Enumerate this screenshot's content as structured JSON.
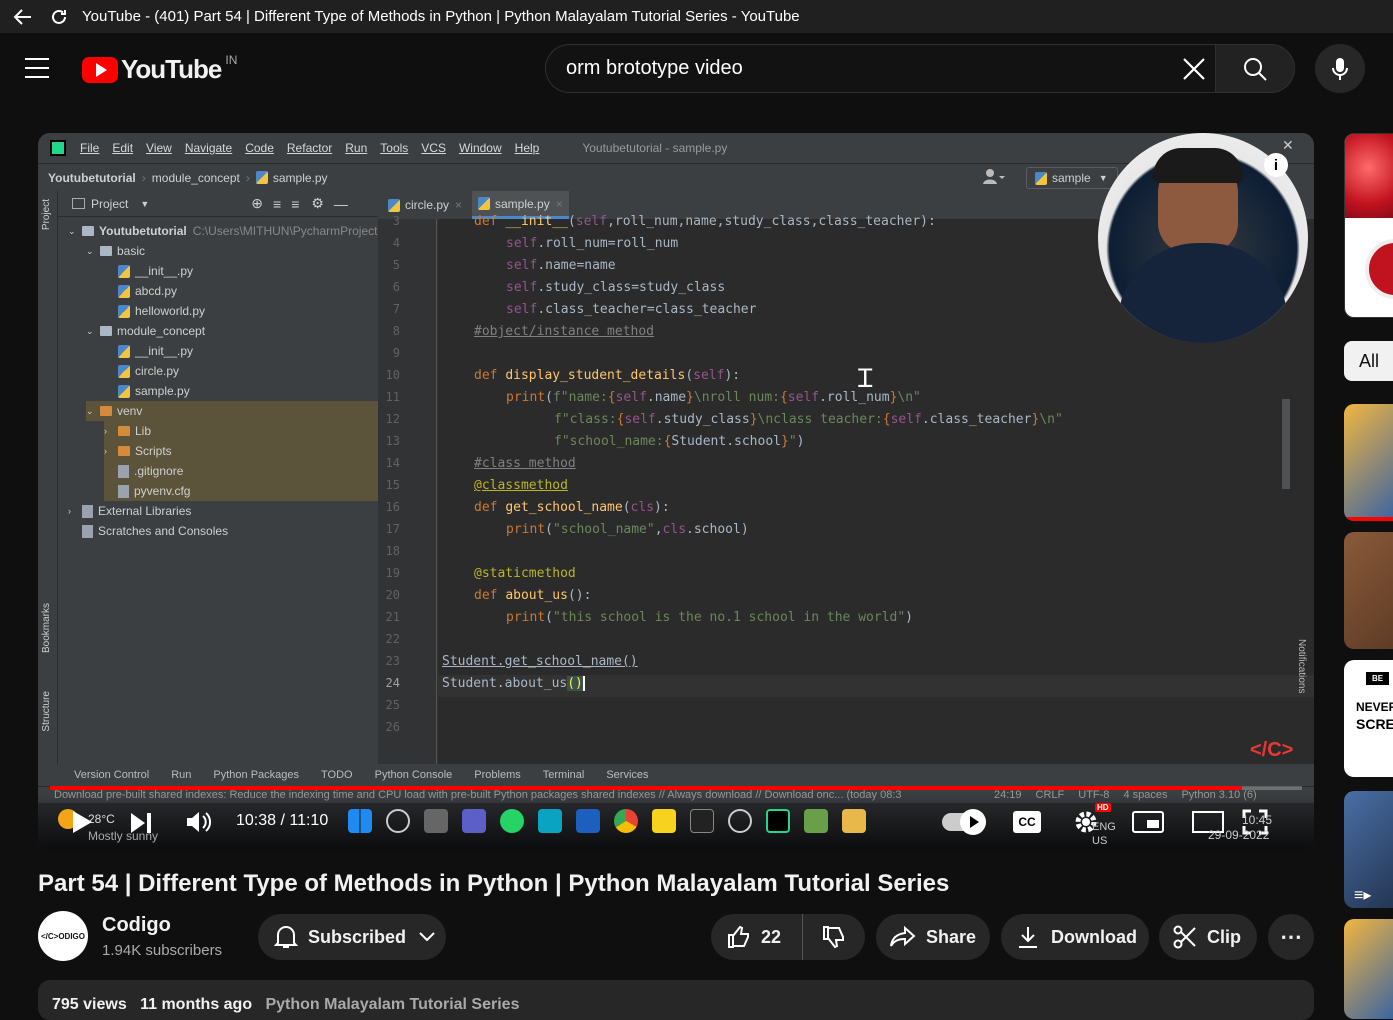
{
  "window": {
    "title": "YouTube - (401) Part 54 | Different Type of Methods in Python | Python Malayalam Tutorial Series - YouTube"
  },
  "header": {
    "logo_text": "YouTube",
    "region": "IN",
    "search_value": "orm brototype video"
  },
  "ide": {
    "menu": [
      "File",
      "Edit",
      "View",
      "Navigate",
      "Code",
      "Refactor",
      "Run",
      "Tools",
      "VCS",
      "Window",
      "Help"
    ],
    "window_title": "Youtubetutorial - sample.py",
    "breadcrumb": [
      "Youtubetutorial",
      "module_concept",
      "sample.py"
    ],
    "run_config": "sample",
    "project_label": "Project",
    "tabs": [
      "circle.py",
      "sample.py"
    ],
    "tree": [
      {
        "indent": 0,
        "label": "Youtubetutorial",
        "path": "C:\\Users\\MITHUN\\PycharmProject",
        "type": "folder"
      },
      {
        "indent": 1,
        "label": "basic",
        "type": "folder"
      },
      {
        "indent": 2,
        "label": "__init__.py",
        "type": "py"
      },
      {
        "indent": 2,
        "label": "abcd.py",
        "type": "py"
      },
      {
        "indent": 2,
        "label": "helloworld.py",
        "type": "py"
      },
      {
        "indent": 1,
        "label": "module_concept",
        "type": "folder"
      },
      {
        "indent": 2,
        "label": "__init__.py",
        "type": "py"
      },
      {
        "indent": 2,
        "label": "circle.py",
        "type": "py"
      },
      {
        "indent": 2,
        "label": "sample.py",
        "type": "py"
      },
      {
        "indent": 1,
        "label": "venv",
        "type": "ofolder"
      },
      {
        "indent": 2,
        "label": "Lib",
        "type": "ofolder"
      },
      {
        "indent": 2,
        "label": "Scripts",
        "type": "ofolder"
      },
      {
        "indent": 2,
        "label": ".gitignore",
        "type": "txt"
      },
      {
        "indent": 2,
        "label": "pyvenv.cfg",
        "type": "txt"
      },
      {
        "indent": 0,
        "label": "External Libraries",
        "type": "lib"
      },
      {
        "indent": 0,
        "label": "Scratches and Consoles",
        "type": "scratch"
      }
    ],
    "line_numbers": [
      "3",
      "4",
      "5",
      "6",
      "7",
      "8",
      "9",
      "10",
      "11",
      "12",
      "13",
      "14",
      "15",
      "16",
      "17",
      "18",
      "19",
      "20",
      "21",
      "22",
      "23",
      "24",
      "25",
      "26"
    ],
    "bottom_tools": [
      "Version Control",
      "Run",
      "Python Packages",
      "TODO",
      "Python Console",
      "Problems",
      "Terminal",
      "Services"
    ],
    "status_text": "Download pre-built shared indexes: Reduce the indexing time and CPU load with pre-built Python packages shared indexes // Always download // Download onc... (today 08:3",
    "status_right": [
      "24:19",
      "CRLF",
      "UTF-8",
      "4 spaces",
      "Python 3.10 (6)"
    ],
    "side_labels": [
      "Project",
      "Bookmarks",
      "Structure",
      "Notifications"
    ]
  },
  "player": {
    "time": "10:38 / 11:10",
    "progress": 0.952,
    "weather_temp": "28°C",
    "weather_desc": "Mostly sunny",
    "clock_time": "10:45",
    "clock_date": "29-09-2022",
    "lang": "ENG",
    "lang2": "US",
    "hd_badge": "HD",
    "cc_label": "CC"
  },
  "video": {
    "title": "Part 54 | Different Type of Methods in Python | Python Malayalam Tutorial Series"
  },
  "channel": {
    "name": "Codigo",
    "subscribers": "1.94K subscribers",
    "avatar_text": "</C>ODIGO"
  },
  "actions": {
    "subscribed": "Subscribed",
    "likes": "22",
    "share": "Share",
    "download": "Download",
    "clip": "Clip"
  },
  "description": {
    "views": "795 views",
    "age": "11 months ago",
    "playlist": "Python Malayalam Tutorial Series"
  },
  "sidebar": {
    "chip": "All",
    "thumb_text1": "NEVER",
    "thumb_text2": "SCRE",
    "thumb_badge": "BE"
  },
  "colors": {
    "accent": "#ff0000",
    "ide_bg": "#2b2b2b",
    "keyword": "#cc7832",
    "string": "#6a8759",
    "function": "#ffc66d",
    "self": "#94558d"
  }
}
